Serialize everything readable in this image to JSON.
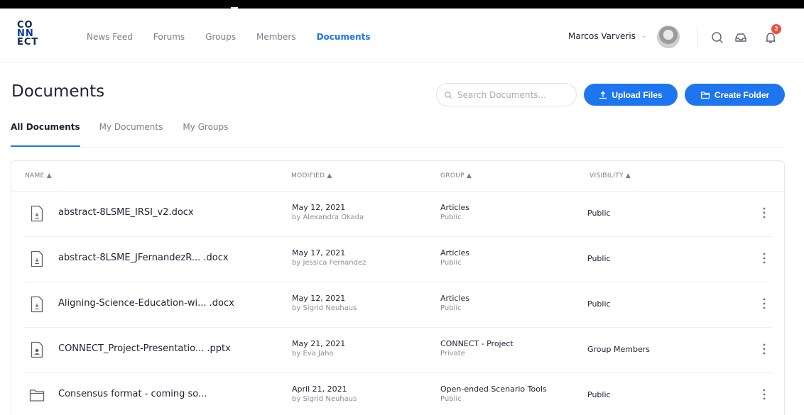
{
  "logo": {
    "line1": "CO",
    "line2": "NN",
    "line3": "ECT"
  },
  "nav": [
    {
      "label": "News Feed",
      "active": false
    },
    {
      "label": "Forums",
      "active": false
    },
    {
      "label": "Groups",
      "active": false
    },
    {
      "label": "Members",
      "active": false
    },
    {
      "label": "Documents",
      "active": true
    }
  ],
  "user": {
    "name": "Marcos Varveris",
    "notifications": "2"
  },
  "icons": {
    "search": "search-icon",
    "inbox": "inbox-icon",
    "bell": "bell-icon",
    "more": "more-vertical-icon"
  },
  "page": {
    "title": "Documents"
  },
  "search": {
    "placeholder": "Search Documents..."
  },
  "buttons": {
    "upload": "Upload Files",
    "create_folder": "Create Folder"
  },
  "tabs": [
    {
      "label": "All Documents",
      "active": true
    },
    {
      "label": "My Documents",
      "active": false
    },
    {
      "label": "My Groups",
      "active": false
    }
  ],
  "table": {
    "headers": {
      "name": "NAME ▲",
      "modified": "MODIFIED ▲",
      "group": "GROUP ▲",
      "visibility": "VISIBILITY ▲"
    },
    "rows": [
      {
        "icon": "doc-icon",
        "name": "abstract-8LSME_IRSI_v2.docx",
        "date": "May 12, 2021",
        "by": "by Alexandra Okada",
        "group": "Articles",
        "group_privacy": "Public",
        "visibility": "Public"
      },
      {
        "icon": "doc-icon",
        "name": "abstract-8LSME_JFernandezR... .docx",
        "date": "May 17, 2021",
        "by": "by Jessica Fernandez",
        "group": "Articles",
        "group_privacy": "Public",
        "visibility": "Public"
      },
      {
        "icon": "doc-icon",
        "name": "Aligning-Science-Education-wi... .docx",
        "date": "May 12, 2021",
        "by": "by Sigrid Neuhaus",
        "group": "Articles",
        "group_privacy": "Public",
        "visibility": "Public"
      },
      {
        "icon": "presentation-icon",
        "name": "CONNECT_Project-Presentatio... .pptx",
        "date": "May 21, 2021",
        "by": "by Eva Jaho",
        "group": "CONNECT - Project",
        "group_privacy": "Private",
        "visibility": "Group Members"
      },
      {
        "icon": "folder-icon",
        "name": "Consensus format - coming so...",
        "date": "April 21, 2021",
        "by": "by Sigrid Neuhaus",
        "group": "Open-ended Scenario Tools",
        "group_privacy": "Public",
        "visibility": "Public"
      }
    ]
  },
  "colors": {
    "accent": "#1d75f0",
    "badge": "#ef4d3f",
    "text": "#1e2133",
    "muted": "#7a7f8c"
  }
}
